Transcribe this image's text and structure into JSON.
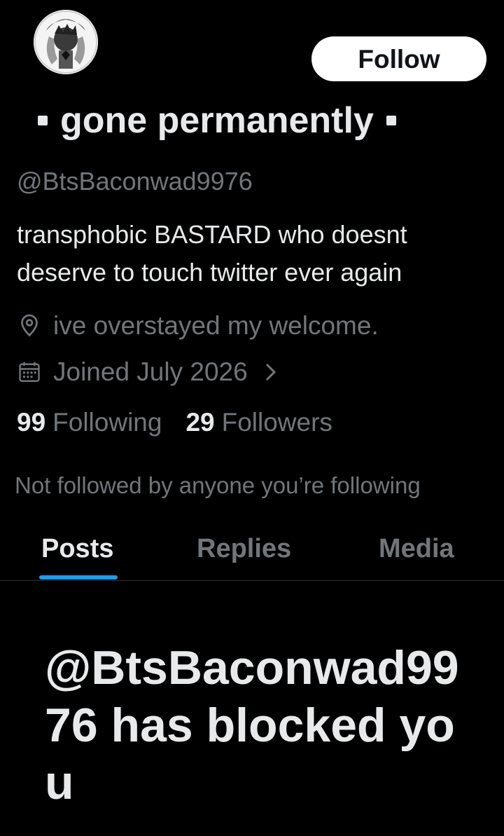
{
  "profile": {
    "display_name": "gone permanently",
    "handle": "@BtsBaconwad9976",
    "bio": "transphobic BASTARD who doesnt deserve to touch twitter ever again",
    "location": "ive overstayed my welcome.",
    "joined": "Joined July 2026",
    "following_count": "99",
    "following_label": "Following",
    "followers_count": "29",
    "followers_label": "Followers",
    "not_followed": "Not followed by anyone you’re following"
  },
  "actions": {
    "follow_label": "Follow"
  },
  "tabs": [
    {
      "label": "Posts",
      "active": true
    },
    {
      "label": "Replies",
      "active": false
    },
    {
      "label": "Media",
      "active": false
    }
  ],
  "blocked_message": "@BtsBaconwad9976 has blocked you",
  "icons": {
    "location": "location-pin-icon",
    "calendar": "calendar-icon",
    "chevron": "chevron-right-icon"
  },
  "colors": {
    "background": "#000000",
    "primary_text": "#e7e9ea",
    "secondary_text": "#71767b",
    "accent": "#1d9bf0",
    "divider": "#2f3336"
  }
}
